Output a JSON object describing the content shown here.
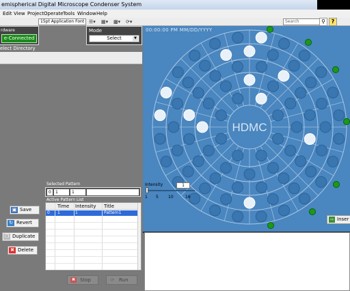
{
  "window": {
    "title": "emispherical Digital Microscope Condenser System"
  },
  "menu": [
    "Edit",
    "View",
    "Project",
    "Operate",
    "Tools",
    "Window",
    "Help"
  ],
  "toolbar": {
    "font": "15pt Application Font",
    "search_placeholder": "Search",
    "help": "?"
  },
  "hardware": {
    "label": "rdware",
    "status": "e-Connected"
  },
  "mode": {
    "label": "Mode",
    "value": "Select"
  },
  "directory": {
    "label": "elect Directory"
  },
  "selected_pattern": {
    "label": "Selected Pattern",
    "field1": "0",
    "field2": "1",
    "field3": "1"
  },
  "active_list": {
    "label": "Active Pattern List",
    "columns": [
      "Time",
      "Intensity",
      "Title"
    ],
    "rows": [
      {
        "index": "0",
        "time": "1",
        "intensity": "1",
        "title": "Pattern1"
      }
    ]
  },
  "buttons": {
    "save": "Save",
    "revert": "Revert",
    "duplicate": "Duplicate",
    "delete": "Delete",
    "stop": "Stop",
    "run": "Run",
    "insert": "Inser"
  },
  "display": {
    "timestamp": "00:00:00 PM  MM/DD/YYYY",
    "logo": "HDMC",
    "intensity_label": "Intensity",
    "intensity_value": "1",
    "intensity_level": 1,
    "intensity_ticks": [
      "1",
      "5",
      "10",
      "16"
    ]
  },
  "colors": {
    "panel_bg": "#4a86bf",
    "led_on": "#e8f0f8",
    "led_off": "#3a76b0",
    "green_led": "#1a9a1a",
    "connected": "#1a8a1a"
  }
}
